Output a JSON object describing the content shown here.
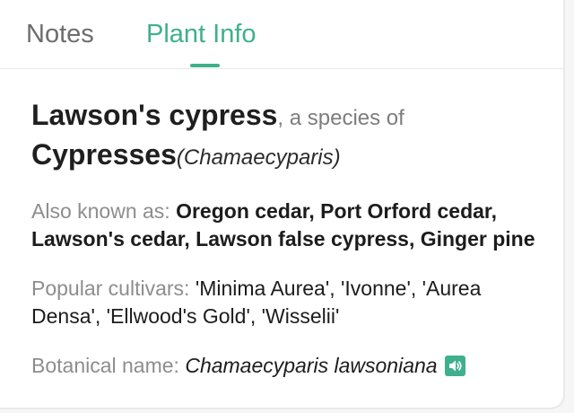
{
  "tabs": [
    {
      "label": "Notes",
      "active": false
    },
    {
      "label": "Plant Info",
      "active": true
    }
  ],
  "plant": {
    "name": "Lawson's cypress",
    "species_connector": ", a species of",
    "genus_common": "Cypresses",
    "genus_scientific": "(Chamaecyparis)",
    "also_known_label": "Also known as:",
    "also_known_value": "Oregon cedar, Port Orford cedar, Lawson's cedar, Lawson false cypress, Ginger pine",
    "cultivars_label": "Popular cultivars:",
    "cultivars_value": "'Minima Aurea', 'Ivonne', 'Aurea Densa', 'Ellwood's Gold', 'Wisselii'",
    "botanical_label": "Botanical name:",
    "botanical_value": "Chamaecyparis lawsoniana"
  },
  "icons": {
    "speaker": "speaker-icon"
  },
  "colors": {
    "accent": "#3fb08b",
    "muted_text": "#8d8d8d",
    "inactive_tab": "#6d6d6d"
  }
}
